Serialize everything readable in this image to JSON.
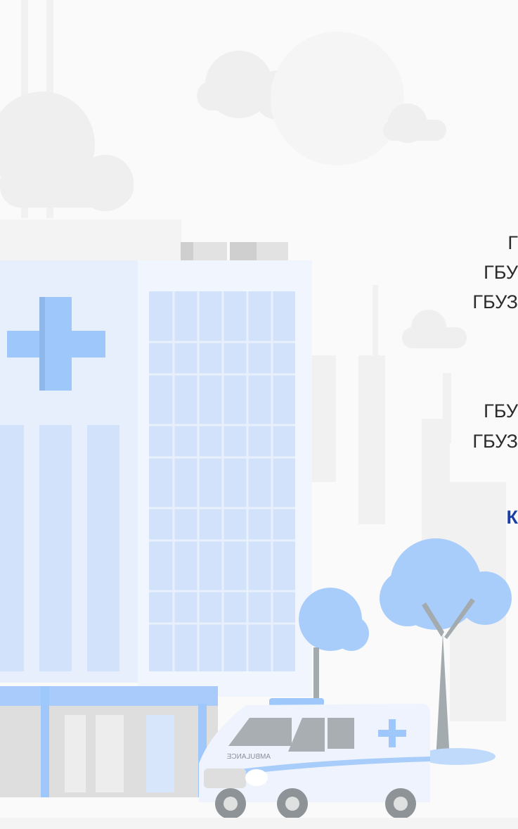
{
  "text": {
    "line1": "Г",
    "line2": "ГБУ",
    "line3": "ГБУЗ",
    "line4": "ГБУ",
    "line5": "ГБУЗ",
    "line6": "К"
  },
  "illustration": {
    "ambulance_label": "AMBULANCE"
  },
  "colors": {
    "sky": "#fafafa",
    "cloud": "#eeeeee",
    "building": "#e7effd",
    "building_side": "#f1f5fe",
    "glass": "#d2e2fb",
    "accent_blue": "#9ec8fb",
    "tree_blue": "#a9cdfb",
    "trunk_gray": "#a4abaf",
    "text_dark": "#2b2b2b",
    "text_blue": "#1a3ea8"
  }
}
